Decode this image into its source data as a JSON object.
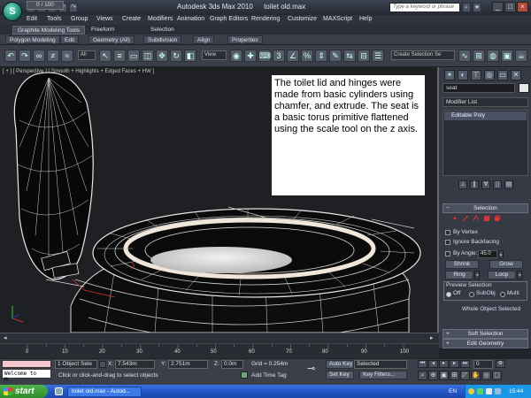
{
  "window": {
    "app_name": "Autodesk 3ds Max  2010",
    "file_name": "toilet old.max",
    "search_placeholder": "Type a keyword or phrase"
  },
  "menu": [
    "Edit",
    "Tools",
    "Group",
    "Views",
    "Create",
    "Modifiers",
    "Animation",
    "Graph Editors",
    "Rendering",
    "Customize",
    "MAXScript",
    "Help"
  ],
  "ribbon": {
    "tabs": [
      "Graphite Modeling Tools",
      "Freeform",
      "Selection"
    ],
    "panels": [
      "Polygon Modeling",
      "Edit",
      "Geometry (All)",
      "Subdivision",
      "Align",
      "Properties"
    ]
  },
  "toolbar": {
    "filter_select": "All",
    "coord_select": "View",
    "named_selection": "Create Selection Se"
  },
  "viewport": {
    "label": "[ + ] [ Perspective ] [ Smooth + Highlights + Edged Faces + HW ]",
    "note": "The toilet lid and hinges were made from basic cylinders using chamfer, and extrude.  The seat is a basic torus primitive flattened using the scale tool on the z axis."
  },
  "command_panel": {
    "object_name": "seat",
    "modifier_list": "Modifier List",
    "stack_item": "Editable Poly",
    "selection_rollout": "Selection",
    "by_vertex": "By Vertex",
    "ignore_backfacing": "Ignore Backfacing",
    "by_angle": "By Angle:",
    "angle_value": "45.0",
    "shrink": "Shrink",
    "grow": "Grow",
    "ring": "Ring",
    "loop": "Loop",
    "preview_selection": "Preview Selection",
    "preview_off": "Off",
    "preview_subobj": "SubObj",
    "preview_multi": "Multi",
    "whole_object_selected": "Whole Object Selected",
    "soft_selection": "Soft Selection",
    "edit_geometry": "Edit Geometry"
  },
  "timeline": {
    "position": "0 / 100",
    "ticks": [
      "0",
      "10",
      "20",
      "30",
      "40",
      "50",
      "60",
      "70",
      "80",
      "90",
      "100"
    ]
  },
  "status": {
    "listener": "Welcome to M...",
    "selected": "1 Object Sele",
    "prompt": "Click or click-and-drag to select objects",
    "x_label": "X:",
    "x_value": "7.543m",
    "y_label": "Y:",
    "y_value": "2.751m",
    "z_label": "Z:",
    "z_value": "0.0m",
    "grid": "Grid = 0.254m",
    "add_time_tag": "Add Time Tag",
    "auto_key": "Auto Key",
    "set_key": "Set Key",
    "key_mode": "Selected",
    "key_filters": "Key Filters...",
    "frame": "0"
  },
  "taskbar": {
    "start": "start",
    "task": "toilet old.max - Autod...",
    "language": "EN",
    "clock": "15:44"
  }
}
